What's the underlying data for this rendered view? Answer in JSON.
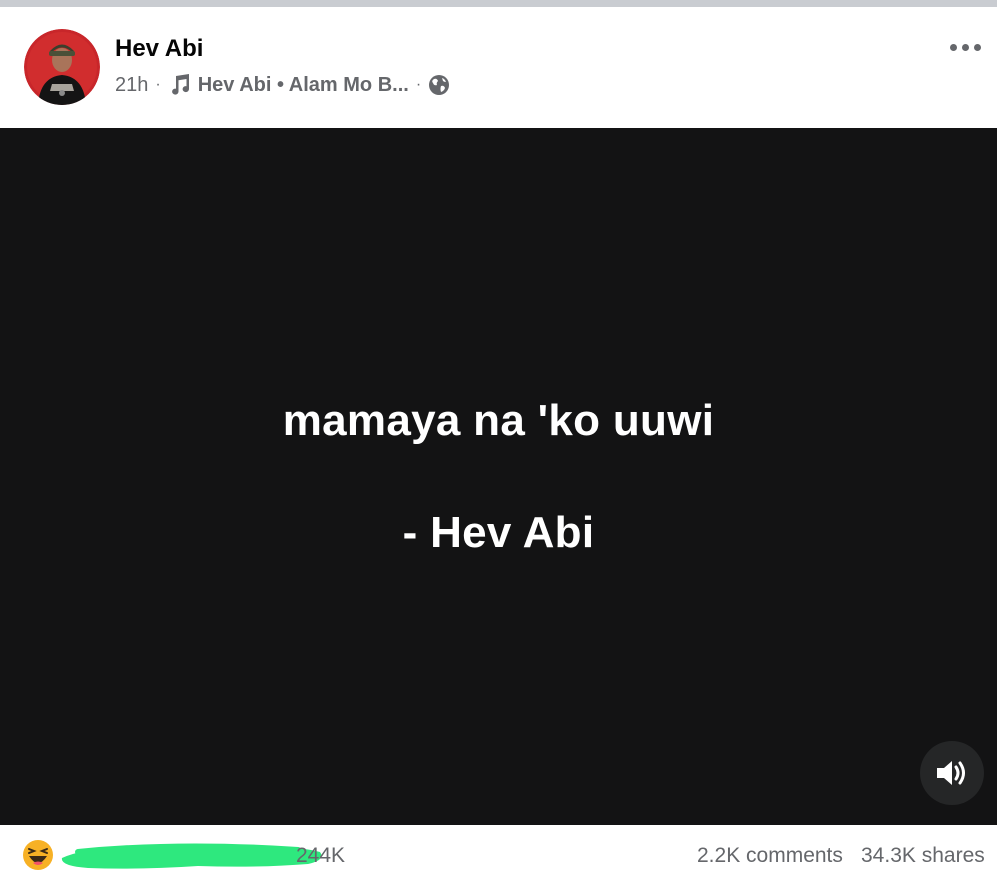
{
  "post": {
    "author": "Hev Abi",
    "time": "21h",
    "separator": "·",
    "audio": "Hev Abi • Alam Mo B...",
    "privacy_icon": "globe-icon",
    "more_icon": "more-dots-icon"
  },
  "video": {
    "lyric_line": "mamaya na 'ko uuwi",
    "attribution": "- Hev Abi",
    "volume_icon": "volume-icon",
    "background": "#131314"
  },
  "footer": {
    "reaction_icon": "haha-emoji-icon",
    "reaction_count": "244K",
    "comments": "2.2K comments",
    "shares": "34.3K shares"
  },
  "colors": {
    "text_primary": "#050505",
    "text_secondary": "#65676b",
    "redaction": "#2ee87e"
  }
}
